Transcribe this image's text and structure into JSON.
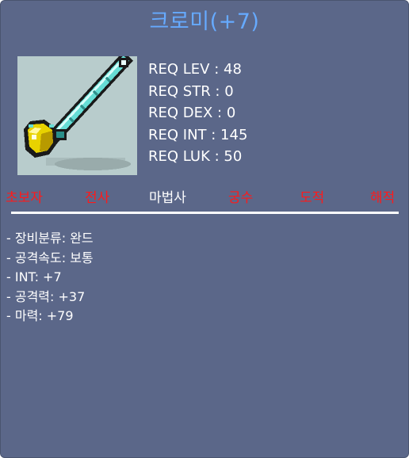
{
  "item": {
    "name": "크로미(+7)",
    "requirements": [
      "REQ LEV : 48",
      "REQ STR : 0",
      "REQ DEX : 0",
      "REQ INT : 145",
      "REQ LUK : 50"
    ],
    "jobs": [
      {
        "label": "초보자",
        "available": false
      },
      {
        "label": "전사",
        "available": false
      },
      {
        "label": "마법사",
        "available": true
      },
      {
        "label": "궁수",
        "available": false
      },
      {
        "label": "도적",
        "available": false
      },
      {
        "label": "해적",
        "available": false
      }
    ],
    "stats": [
      "- 장비분류: 완드",
      "- 공격속도: 보통",
      "- INT: +7",
      "- 공격력: +37",
      "- 마력: +79"
    ],
    "icon": "wand-icon"
  },
  "colors": {
    "panel_bg": "#5b6789",
    "title": "#66aaff",
    "job_available": "#ffffff",
    "job_unavailable": "#ff1a1a",
    "image_bg": "#b8cccc"
  }
}
